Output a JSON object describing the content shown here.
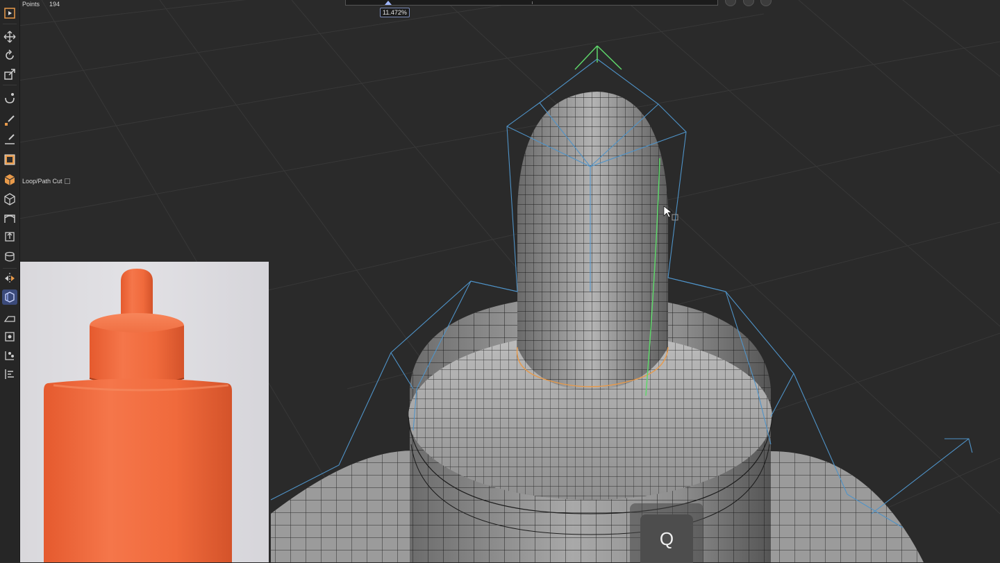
{
  "hud": {
    "points_label": "Points",
    "points_value": "194"
  },
  "tool_hint": {
    "label": "Loop/Path Cut"
  },
  "cut_slider": {
    "value_label": "11.472%",
    "value_fraction": 0.11472
  },
  "key_overlay": {
    "key": "Q"
  },
  "toolbar": {
    "icons": [
      "selection-tool-icon",
      "move-icon",
      "rotate-icon",
      "scale-icon",
      "magnet-icon",
      "knife-icon",
      "bevel-icon",
      "polygon-icon",
      "cube-orange-icon",
      "cube-icon",
      "bridge-icon",
      "extrude-icon",
      "cylinder-icon",
      "mirror-icon",
      "loop-cut-icon",
      "iron-icon",
      "subdivide-icon",
      "weld-icon",
      "align-icon"
    ],
    "active": "loop-cut-icon"
  },
  "colors": {
    "background": "#2a2a2a",
    "grid": "#3a3a3a",
    "mesh": "#a6a6a6",
    "cage": "#4f93c8",
    "selected_loop": "#e89a4a",
    "cut_preview": "#5ed66a",
    "product_orange": "#f06a3c"
  }
}
